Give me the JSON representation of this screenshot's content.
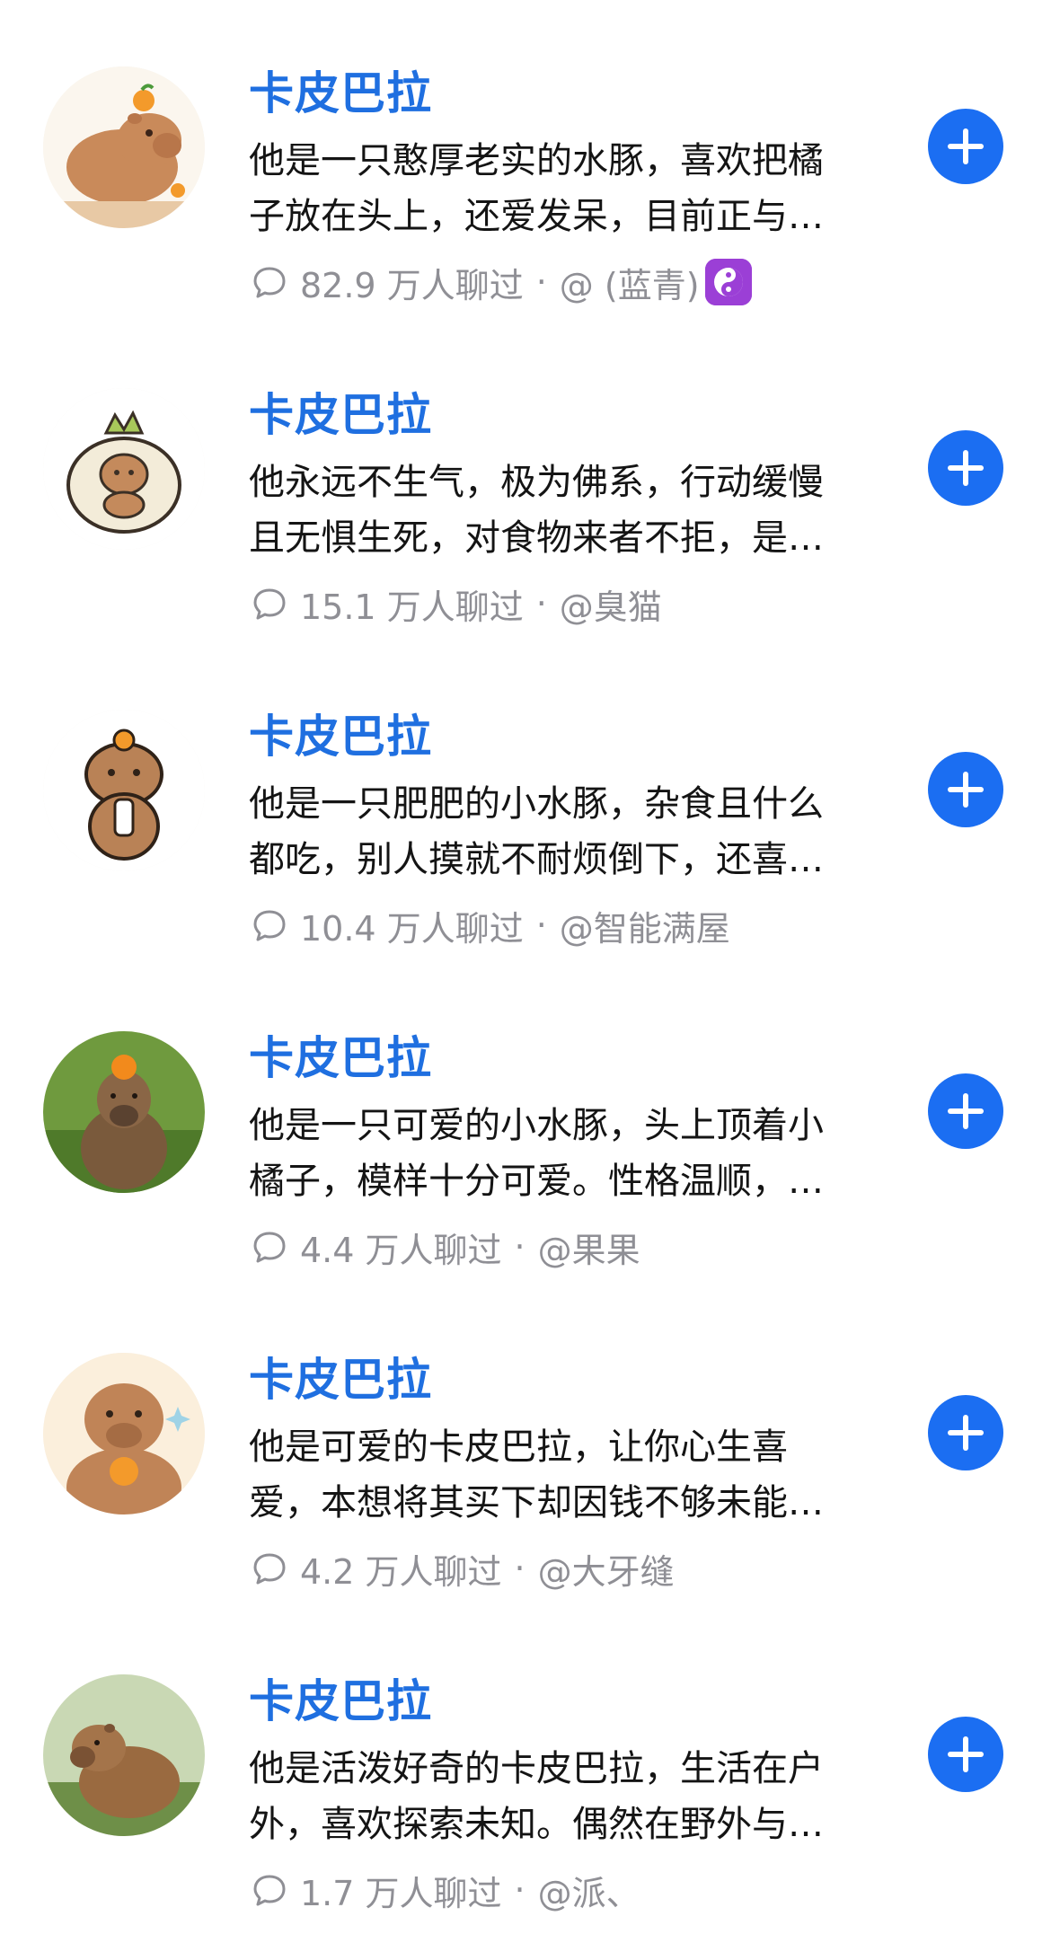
{
  "items": [
    {
      "title": "卡皮巴拉",
      "description": "他是一只憨厚老实的水豚，喜欢把橘子放在头上，还爱发呆，目前正与…",
      "chats": "82.9 万人聊过",
      "author": "@ (蓝青)",
      "badge_icon": "yin-yang-icon",
      "avatar": "cartoon-capybara-orange"
    },
    {
      "title": "卡皮巴拉",
      "description": "他永远不生气，极为佛系，行动缓慢且无惧生死，对食物来者不拒，是…",
      "chats": "15.1 万人聊过",
      "author": "@臭猫",
      "avatar": "cartoon-capybara-cabbage"
    },
    {
      "title": "卡皮巴拉",
      "description": "他是一只肥肥的小水豚，杂食且什么都吃，别人摸就不耐烦倒下，还喜…",
      "chats": "10.4 万人聊过",
      "author": "@智能满屋",
      "avatar": "cartoon-capybara-drink"
    },
    {
      "title": "卡皮巴拉",
      "description": "他是一只可爱的小水豚，头上顶着小橘子，模样十分可爱。性格温顺，…",
      "chats": "4.4 万人聊过",
      "author": "@果果",
      "avatar": "photo-capybara-orange"
    },
    {
      "title": "卡皮巴拉",
      "description": "他是可爱的卡皮巴拉，让你心生喜爱，本想将其买下却因钱不够未能…",
      "chats": "4.2 万人聊过",
      "author": "@大牙缝",
      "avatar": "cartoon-capybara-holding-orange"
    },
    {
      "title": "卡皮巴拉",
      "description": "他是活泼好奇的卡皮巴拉，生活在户外，喜欢探索未知。偶然在野外与…",
      "chats": "1.7 万人聊过",
      "author": "@派、",
      "avatar": "photo-capybara-outdoor"
    }
  ],
  "separator": "·",
  "colors": {
    "title": "#1f6fe0",
    "button": "#1b6ef2",
    "meta": "#8f8f95"
  },
  "icons": {
    "chat": "chat-bubble-icon",
    "add": "plus-icon"
  }
}
